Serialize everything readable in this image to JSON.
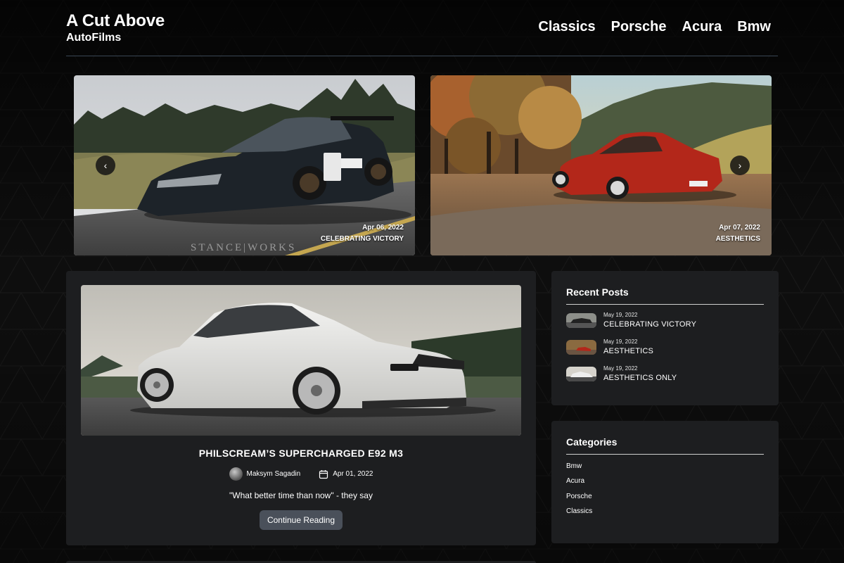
{
  "header": {
    "title": "A Cut Above",
    "subtitle": "AutoFilms",
    "nav": [
      "Classics",
      "Porsche",
      "Acura",
      "Bmw"
    ]
  },
  "slides": [
    {
      "date": "Apr 06, 2022",
      "category": "CELEBRATING VICTORY",
      "watermark": "STANCE|WORKS"
    },
    {
      "date": "Apr 07, 2022",
      "category": "AESTHETICS"
    }
  ],
  "carousel": {
    "prev_icon": "chevron-left-icon",
    "next_icon": "chevron-right-icon",
    "prev_glyph": "‹",
    "next_glyph": "›"
  },
  "post": {
    "title": "PHILSCREAM’S SUPERCHARGED E92 M3",
    "author": "Maksym Sagadin",
    "date": "Apr 01, 2022",
    "excerpt": "\"What better time than now\" - they say",
    "button_label": "Continue Reading"
  },
  "recent_posts": {
    "title": "Recent Posts",
    "items": [
      {
        "date": "May 19, 2022",
        "name": "CELEBRATING VICTORY"
      },
      {
        "date": "May 19, 2022",
        "name": "AESTHETICS"
      },
      {
        "date": "May 19, 2022",
        "name": "AESTHETICS ONLY"
      }
    ]
  },
  "categories": {
    "title": "Categories",
    "items": [
      "Bmw",
      "Acura",
      "Porsche",
      "Classics"
    ]
  },
  "colors": {
    "background": "#0b0b0b",
    "card": "#1d1e20",
    "button": "#4a505a",
    "rule": "#3a4654"
  }
}
